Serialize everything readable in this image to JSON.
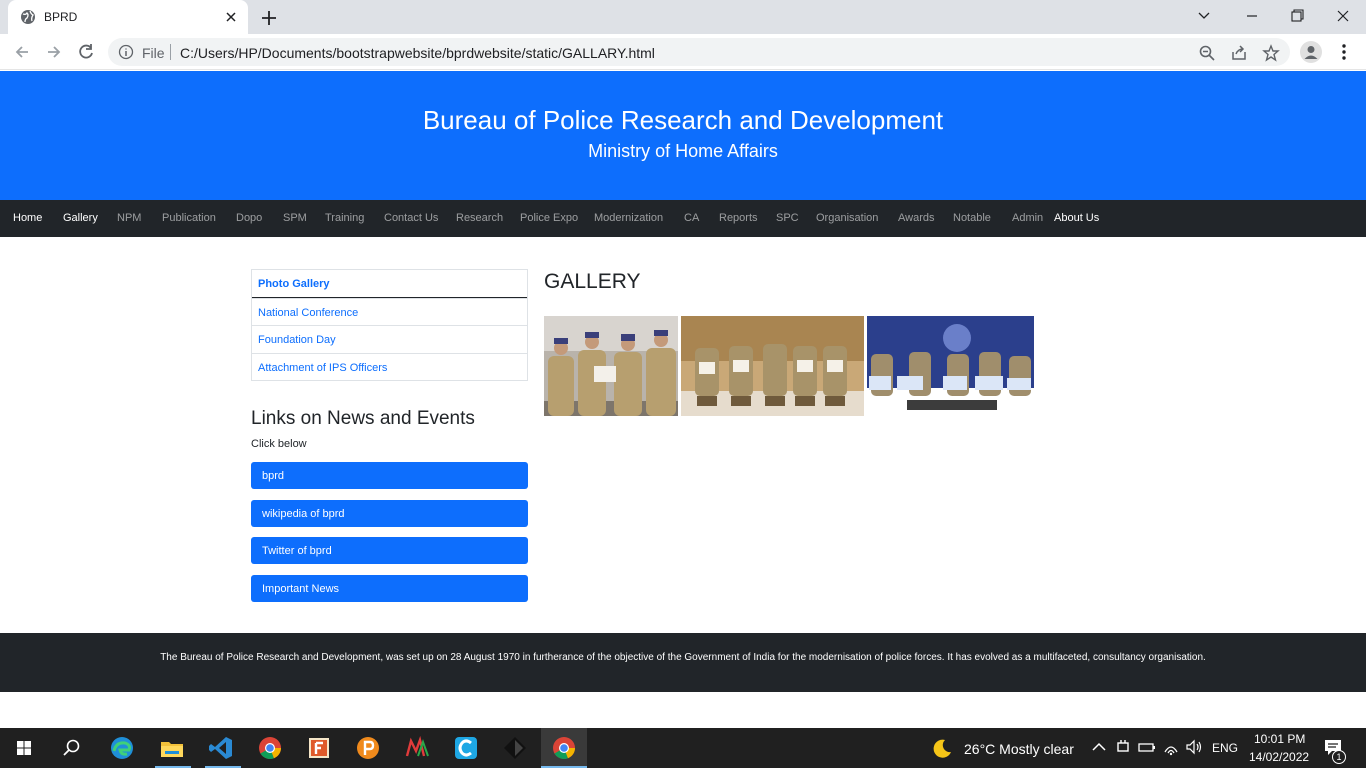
{
  "browser": {
    "tab_title": "BPRD",
    "address_prefix": "File",
    "url": "C:/Users/HP/Documents/bootstrapwebsite/bprdwebsite/static/GALLARY.html"
  },
  "header": {
    "title": "Bureau of Police Research and Development",
    "subtitle": "Ministry of Home Affairs"
  },
  "nav": {
    "items": [
      "Home",
      "Gallery",
      "NPM",
      "Publication",
      "Dopo",
      "SPM",
      "Training",
      "Contact Us",
      "Research",
      "Police Expo",
      "Modernization",
      "CA",
      "Reports",
      "SPC",
      "Organisation",
      "Awards",
      "Notable",
      "Admin",
      "About Us"
    ]
  },
  "sidebar": {
    "list": [
      "Photo Gallery",
      "National Conference",
      "Foundation Day",
      "Attachment of IPS Officers"
    ],
    "links_title": "Links on News and Events",
    "click_below": "Click below",
    "buttons": [
      "bprd",
      "wikipedia of bprd",
      "Twitter of bprd",
      "Important News"
    ]
  },
  "gallery": {
    "title": "GALLERY"
  },
  "footer": {
    "text": "The Bureau of Police Research and Development, was set up on 28 August 1970 in furtherance of the objective of the Government of India for the modernisation of police forces. It has evolved as a multifaceted, consultancy organisation."
  },
  "taskbar": {
    "weather": "26°C  Mostly clear",
    "lang": "ENG",
    "time": "10:01 PM",
    "date": "14/02/2022",
    "notif_count": "1"
  },
  "colors": {
    "primary": "#0d6efd",
    "dark": "#212529"
  }
}
